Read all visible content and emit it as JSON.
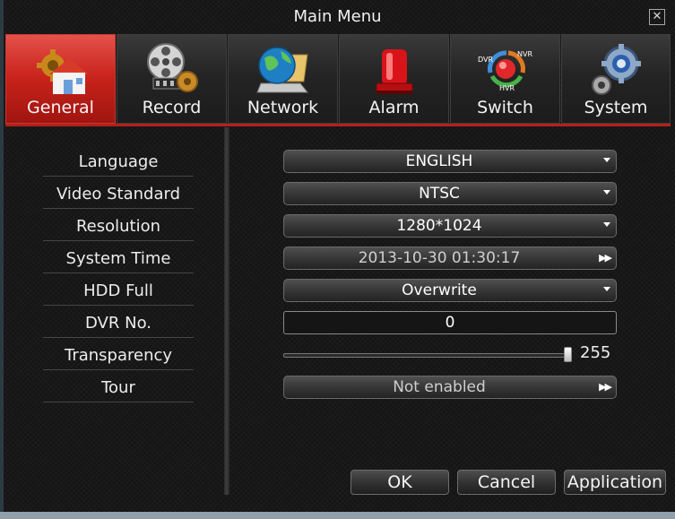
{
  "window": {
    "title": "Main Menu",
    "close_icon": "close-icon"
  },
  "tabs": [
    {
      "label": "General",
      "icon": "house-gear-icon",
      "active": true
    },
    {
      "label": "Record",
      "icon": "film-reel-icon",
      "active": false
    },
    {
      "label": "Network",
      "icon": "globe-laptop-icon",
      "active": false
    },
    {
      "label": "Alarm",
      "icon": "siren-icon",
      "active": false
    },
    {
      "label": "Switch",
      "icon": "dvr-nvr-hvr-switch-icon",
      "active": false,
      "icon_text": [
        "DVR",
        "NVR",
        "HVR"
      ]
    },
    {
      "label": "System",
      "icon": "gears-icon",
      "active": false
    }
  ],
  "fields": [
    {
      "label": "Language",
      "value": "ENGLISH",
      "control": "dropdown"
    },
    {
      "label": "Video Standard",
      "value": "NTSC",
      "control": "dropdown"
    },
    {
      "label": "Resolution",
      "value": "1280*1024",
      "control": "dropdown"
    },
    {
      "label": "System Time",
      "value": "2013-10-30 01:30:17",
      "control": "expand"
    },
    {
      "label": "HDD Full",
      "value": "Overwrite",
      "control": "dropdown"
    },
    {
      "label": "DVR No.",
      "value": "0",
      "control": "input"
    },
    {
      "label": "Transparency",
      "value": "255",
      "control": "slider",
      "level_fraction": 1.0
    },
    {
      "label": "Tour",
      "value": "Not enabled",
      "control": "expand"
    }
  ],
  "buttons": {
    "ok": "OK",
    "cancel": "Cancel",
    "application": "Application"
  },
  "colors": {
    "accent_red": "#c8231c",
    "background": "#151515",
    "text": "#f2f2f2"
  }
}
